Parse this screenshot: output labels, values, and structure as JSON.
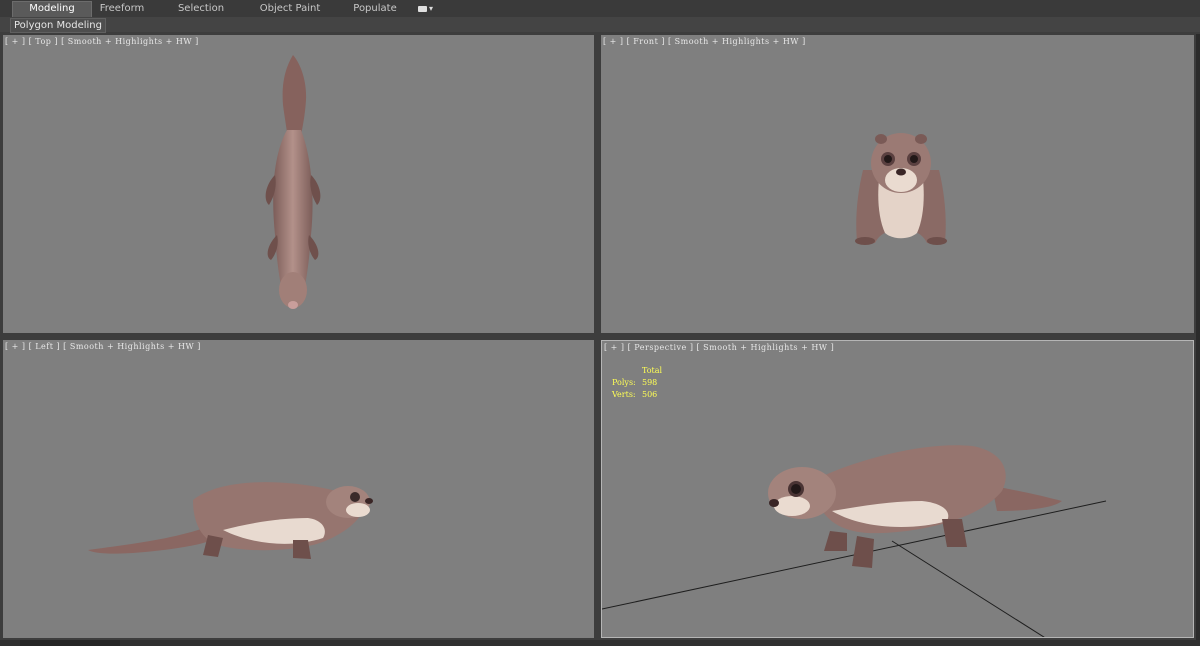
{
  "ribbon": {
    "tabs": [
      {
        "label": "Modeling",
        "active": true
      },
      {
        "label": "Freeform",
        "active": false
      },
      {
        "label": "Selection",
        "active": false
      },
      {
        "label": "Object Paint",
        "active": false
      },
      {
        "label": "Populate",
        "active": false
      }
    ],
    "dropdown_icon": "camera-dropdown-icon"
  },
  "panel": {
    "label": "Polygon Modeling"
  },
  "viewports": {
    "top": {
      "label": "[ + ] [ Top ] [ Smooth + Highlights + HW ]"
    },
    "front": {
      "label": "[ + ] [ Front ] [ Smooth + Highlights + HW ]"
    },
    "left": {
      "label": "[ + ] [ Left ] [ Smooth + Highlights + HW ]"
    },
    "perspective": {
      "label": "[ + ] [ Perspective ] [ Smooth + Highlights + HW ]",
      "stats": {
        "header": "Total",
        "polys_label": "Polys:",
        "polys_value": "598",
        "verts_label": "Verts:",
        "verts_value": "506"
      }
    }
  },
  "colors": {
    "viewport_bg": "#7f7f7f",
    "otter_fur": "#93716c",
    "otter_belly": "#e6d6cc",
    "stats_text": "#ffff55"
  }
}
